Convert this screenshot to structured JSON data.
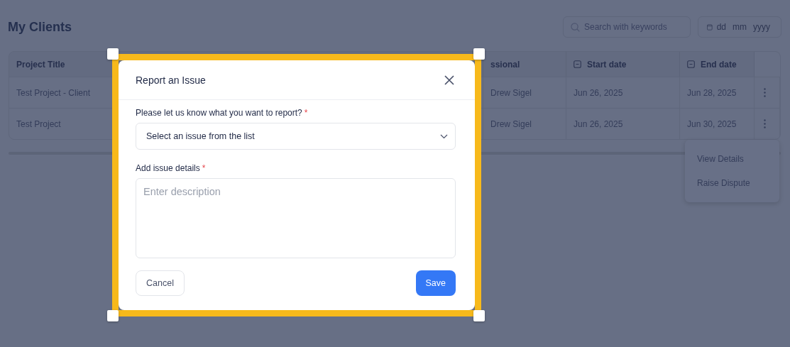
{
  "page": {
    "title": "My Clients"
  },
  "search": {
    "placeholder": "Search with keywords"
  },
  "date_field": {
    "parts": [
      "dd",
      "mm",
      "yyyy"
    ]
  },
  "table": {
    "columns": [
      {
        "label": "Project Title",
        "kind": "text"
      },
      {
        "label": "ssional",
        "kind": "text"
      },
      {
        "label": "Start date",
        "kind": "date"
      },
      {
        "label": "End date",
        "kind": "date"
      }
    ],
    "rows": [
      {
        "cells": [
          "Test Project - Client",
          "Drew Sigel",
          "Jun 26, 2025",
          "Jun 28, 2025"
        ]
      },
      {
        "cells": [
          "Test Project",
          "Drew Sigel",
          "Jun 26, 2025",
          "Jun 30, 2025"
        ]
      }
    ]
  },
  "row_menu": {
    "items": [
      "View Details",
      "Raise Dispute"
    ]
  },
  "dialog": {
    "title": "Report an Issue",
    "issue_field": {
      "label": "Please let us know what you want to report?",
      "required_mark": "*",
      "value": "Select an issue from the list"
    },
    "details_field": {
      "label": "Add issue details",
      "required_mark": "*",
      "placeholder": "Enter description"
    },
    "buttons": [
      {
        "label": "Cancel",
        "kind": "secondary"
      },
      {
        "label": "Save",
        "kind": "primary"
      }
    ]
  }
}
